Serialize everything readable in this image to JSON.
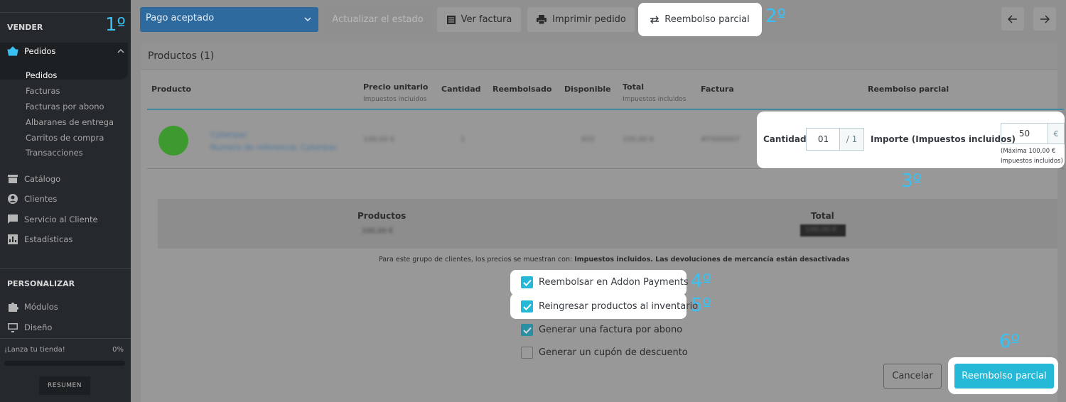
{
  "sidebar": {
    "section_sell": "VENDER",
    "orders": "Pedidos",
    "orders_sub": [
      "Pedidos",
      "Facturas",
      "Facturas por abono",
      "Albaranes de entrega",
      "Carritos de compra",
      "Transacciones"
    ],
    "catalog": "Catálogo",
    "customers": "Clientes",
    "customer_service": "Servicio al Cliente",
    "stats": "Estadísticas",
    "section_customize": "PERSONALIZAR",
    "modules": "Módulos",
    "design": "Diseño",
    "launch_label": "¡Lanza tu tienda!",
    "launch_value": "0%",
    "launch_progress": 0,
    "summary_button": "RESUMEN"
  },
  "steps": {
    "s1": "1º",
    "s2": "2º",
    "s3": "3º",
    "s4": "4º",
    "s5": "5º",
    "s6": "6º"
  },
  "toolbar": {
    "status": "Pago aceptado",
    "update_status": "Actualizar el estado",
    "view_invoice": "Ver factura",
    "print_order": "Imprimir pedido",
    "partial_refund": "Reembolso parcial"
  },
  "products": {
    "title": "Productos (1)",
    "columns": {
      "product": "Producto",
      "unit_price": "Precio unitario",
      "unit_price_sub": "Impuestos incluidos",
      "quantity": "Cantidad",
      "refunded": "Reembolsado",
      "available": "Disponible",
      "total": "Total",
      "total_sub": "Impuestos incluidos",
      "invoice": "Factura",
      "partial_refund": "Reembolso parcial"
    },
    "row": {
      "name": "Cyberpac",
      "reference": "Numero de referencia: Cyberpac",
      "unit_price": "100,00 €",
      "quantity": "1",
      "available": "932",
      "total": "100,00 €",
      "invoice": "#FI000007"
    },
    "refund": {
      "qty_label": "Cantidad",
      "qty_value": "01",
      "qty_max": "/ 1",
      "amount_label": "Importe (Impuestos incluidos)",
      "amount_value": "50",
      "currency": "€",
      "help_line1": "(Máxima 100,00 €",
      "help_line2": "Impuestos incluidos)"
    }
  },
  "summary": {
    "products_label": "Productos",
    "products_value": "100,00 €",
    "total_label": "Total",
    "total_value": "100,00 €"
  },
  "note": {
    "prefix": "Para este grupo de clientes, los precios se muestran con: ",
    "bold": "Impuestos incluidos. Las devoluciones de mercancía están desactivadas"
  },
  "options": {
    "refund_addon": "Reembolsar en Addon Payments",
    "restock": "Reingresar productos al inventario",
    "credit_slip": "Generar una factura por abono",
    "voucher": "Generar un cupón de descuento"
  },
  "actions": {
    "cancel": "Cancelar",
    "submit": "Reembolso parcial"
  },
  "colors": {
    "accent": "#25b9d7",
    "annotation": "#38c1f2",
    "status_select": "#2e6a9e"
  }
}
